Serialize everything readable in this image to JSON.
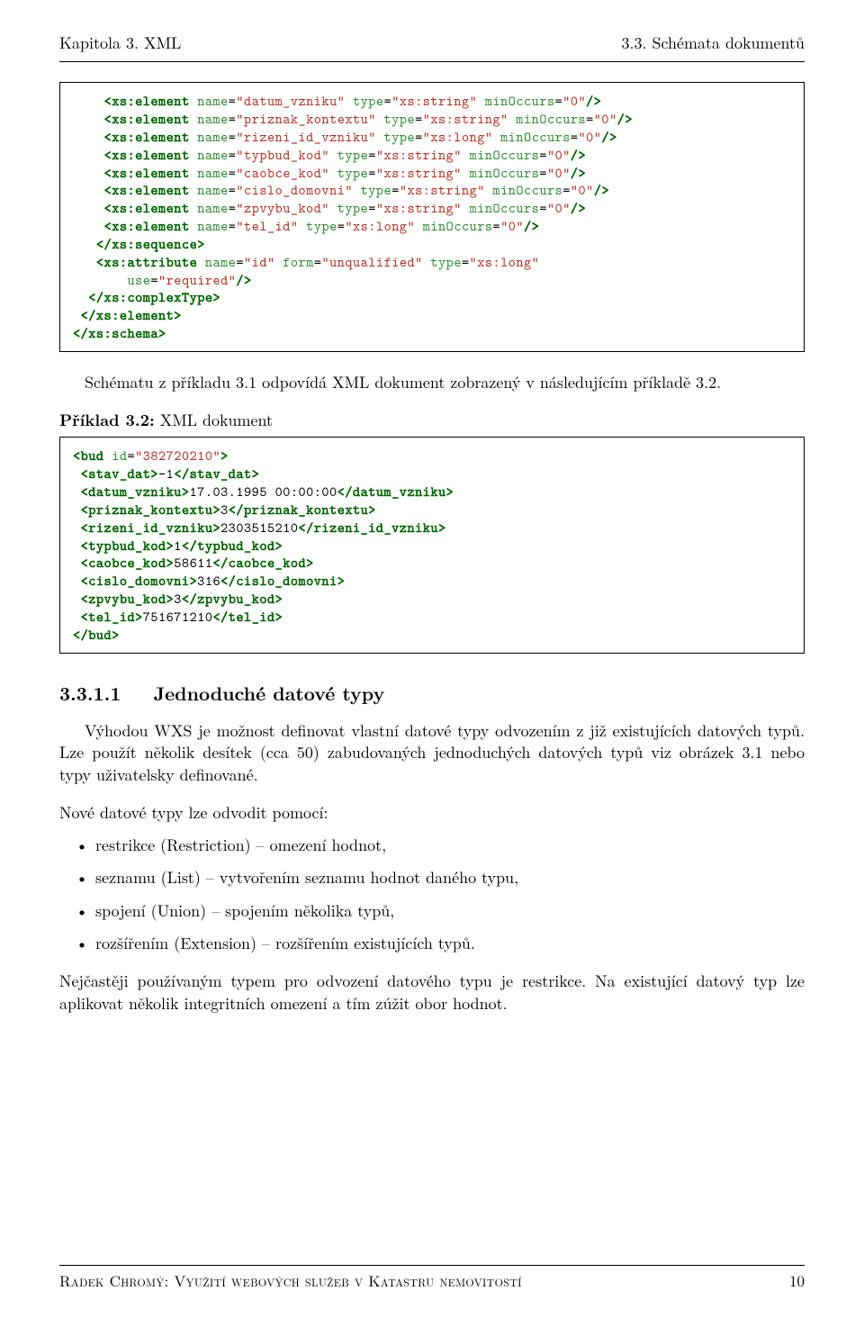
{
  "header": {
    "left": "Kapitola 3. XML",
    "right": "3.3. Schémata dokumentů"
  },
  "code1": {
    "l1": "    <xs:element name=\"datum_vzniku\" type=\"xs:string\" minOccurs=\"0\"/>",
    "l2": "    <xs:element name=\"priznak_kontextu\" type=\"xs:string\" minOccurs=\"0\"/>",
    "l3": "    <xs:element name=\"rizeni_id_vzniku\" type=\"xs:long\" minOccurs=\"0\"/>",
    "l4": "    <xs:element name=\"typbud_kod\" type=\"xs:string\" minOccurs=\"0\"/>",
    "l5": "    <xs:element name=\"caobce_kod\" type=\"xs:string\" minOccurs=\"0\"/>",
    "l6": "    <xs:element name=\"cislo_domovni\" type=\"xs:string\" minOccurs=\"0\"/>",
    "l7": "    <xs:element name=\"zpvybu_kod\" type=\"xs:string\" minOccurs=\"0\"/>",
    "l8": "    <xs:element name=\"tel_id\" type=\"xs:long\" minOccurs=\"0\"/>",
    "l9": "   </xs:sequence>",
    "l10a": "   <xs:attribute name=\"id\" form=\"unqualified\" type=\"xs:long\"",
    "l10b": "       use=\"required\"/>",
    "l11": "  </xs:complexType>",
    "l12": " </xs:element>",
    "l13": "</xs:schema>"
  },
  "para1": "Schématu z příkladu 3.1 odpovídá XML dokument zobrazený v následujícím příkladě 3.2.",
  "caption2": {
    "bold": "Příklad 3.2:",
    "rest": "   XML dokument"
  },
  "code2": {
    "l1": "<bud id=\"382720210\">",
    "l2": " <stav_dat>-1</stav_dat>",
    "l3": " <datum_vzniku>17.03.1995 00:00:00</datum_vzniku>",
    "l4": " <priznak_kontextu>3</priznak_kontextu>",
    "l5": " <rizeni_id_vzniku>2303515210</rizeni_id_vzniku>",
    "l6": " <typbud_kod>1</typbud_kod>",
    "l7": " <caobce_kod>58611</caobce_kod>",
    "l8": " <cislo_domovni>316</cislo_domovni>",
    "l9": " <zpvybu_kod>3</zpvybu_kod>",
    "l10": " <tel_id>751671210</tel_id>",
    "l11": "</bud>"
  },
  "section": {
    "num": "3.3.1.1",
    "title": "Jednoduché datové typy"
  },
  "para2": "Výhodou WXS je možnost definovat vlastní datové typy odvozením z již existujících datových typů. Lze použít několik desítek (cca 50) zabudovaných jednoduchých datových typů viz obrázek 3.1 nebo typy uživatelsky definované.",
  "para3": "Nové datové typy lze odvodit pomocí:",
  "bullets": [
    "restrikce (Restriction) – omezení hodnot,",
    "seznamu (List) – vytvořením seznamu hodnot daného typu,",
    "spojení (Union) – spojením několika typů,",
    "rozšířením (Extension) – rozšířením existujících typů."
  ],
  "para4": "Nejčastěji používaným typem pro odvození datového typu je restrikce. Na existující datový typ lze aplikovat několik integritních omezení a tím zúžit obor hodnot.",
  "footer": {
    "left": "Radek Chromý: Využití webových služeb v Katastru nemovitostí",
    "right": "10"
  }
}
